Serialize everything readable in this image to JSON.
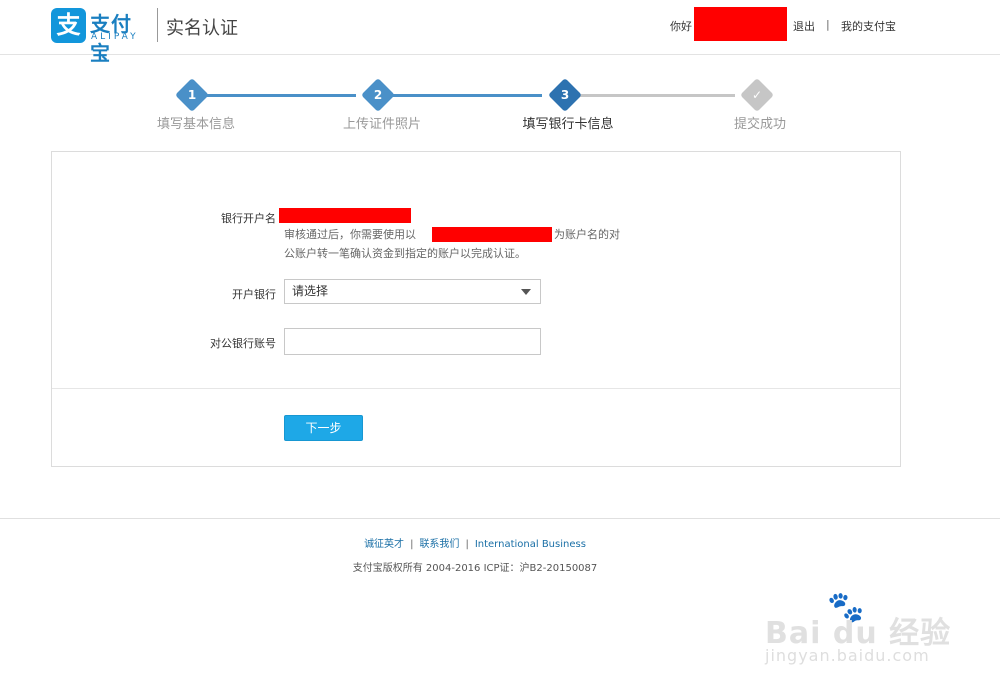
{
  "header": {
    "logo_glyph": "支",
    "logo_cn": "支付宝",
    "logo_en": "ALIPAY",
    "title": "实名认证",
    "greeting": "你好",
    "logout": "退出",
    "separator": "|",
    "my_alipay": "我的支付宝",
    "redact_color": "#ff0000"
  },
  "steps": [
    {
      "num": "1",
      "label": "填写基本信息",
      "state": "done",
      "color": "#4a90c8"
    },
    {
      "num": "2",
      "label": "上传证件照片",
      "state": "done",
      "color": "#4a90c8"
    },
    {
      "num": "3",
      "label": "填写银行卡信息",
      "state": "active",
      "color": "#2d72b0"
    },
    {
      "num": "✓",
      "label": "提交成功",
      "state": "pending",
      "color": "#c6c6c6"
    }
  ],
  "form": {
    "account_name_label": "银行开户名",
    "hint_part1": "审核通过后，你需要使用以",
    "hint_part2": "为账户名的对",
    "hint_line2": "公账户转一笔确认资金到指定的账户以完成认证。",
    "bank_label": "开户银行",
    "bank_select_value": "请选择",
    "account_no_label": "对公银行账号",
    "account_no_value": "",
    "next_button": "下一步"
  },
  "footer": {
    "links": [
      "诚征英才",
      "联系我们",
      "International Business"
    ],
    "separator": "|",
    "copyright": "支付宝版权所有 2004-2016 ICP证：沪B2-20150087"
  },
  "watermark": {
    "paw": "🐾",
    "main": "Bai du 经验",
    "url": "jingyan.baidu.com"
  }
}
